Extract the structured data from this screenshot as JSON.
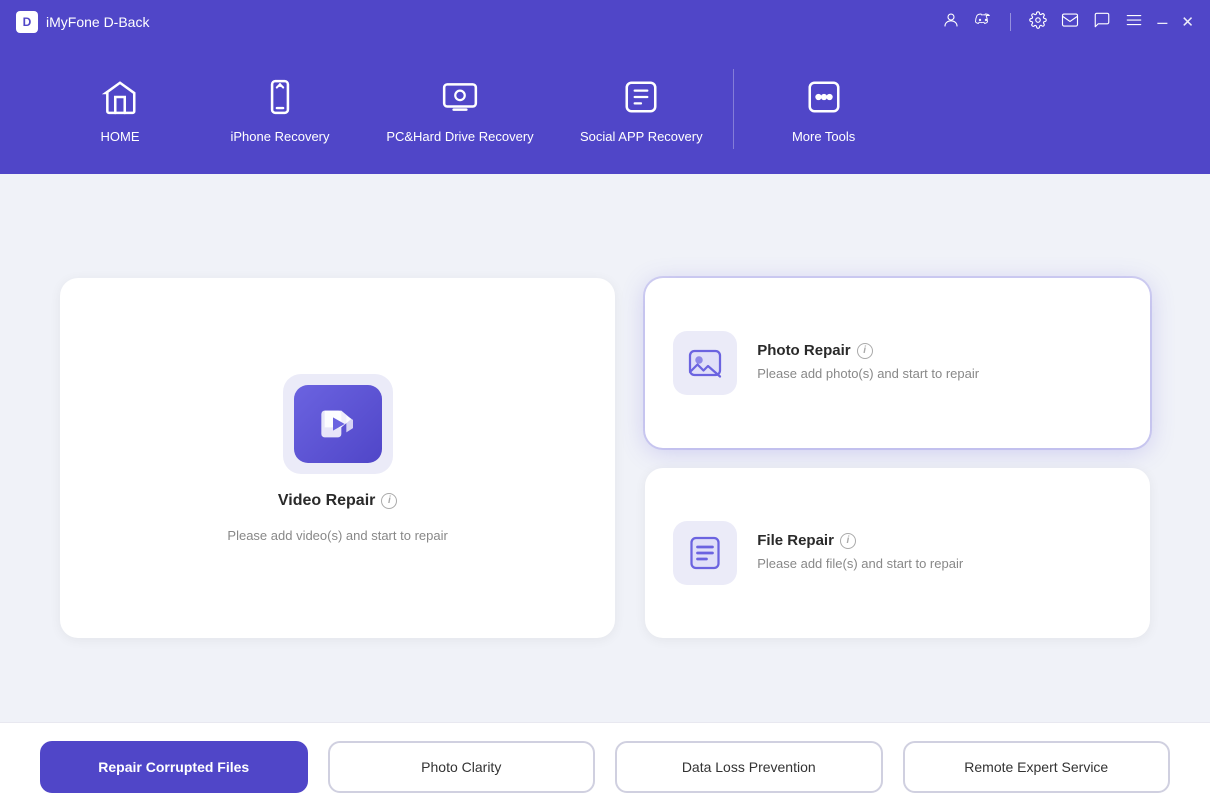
{
  "app": {
    "title": "iMyFone D-Back",
    "logo": "D"
  },
  "titlebar": {
    "icons": [
      "person-icon",
      "discord-icon",
      "settings-icon",
      "mail-icon",
      "chat-icon",
      "menu-icon",
      "minimize-icon",
      "close-icon"
    ],
    "minimize_label": "–",
    "close_label": "✕"
  },
  "nav": {
    "items": [
      {
        "id": "home",
        "label": "HOME",
        "active": false
      },
      {
        "id": "iphone-recovery",
        "label": "iPhone Recovery",
        "active": false
      },
      {
        "id": "pc-hard-drive",
        "label": "PC&Hard Drive Recovery",
        "active": false
      },
      {
        "id": "social-app",
        "label": "Social APP Recovery",
        "active": false
      },
      {
        "id": "more-tools",
        "label": "More Tools",
        "active": true
      }
    ]
  },
  "cards": {
    "left": {
      "title": "Video Repair",
      "info": "i",
      "desc": "Please add video(s) and start to repair"
    },
    "right": [
      {
        "id": "photo-repair",
        "title": "Photo Repair",
        "info": "i",
        "desc": "Please add photo(s) and start to repair",
        "active": true
      },
      {
        "id": "file-repair",
        "title": "File Repair",
        "info": "i",
        "desc": "Please add file(s) and start to repair",
        "active": false
      }
    ]
  },
  "bottom": {
    "buttons": [
      {
        "id": "repair-corrupted",
        "label": "Repair Corrupted Files",
        "primary": true
      },
      {
        "id": "photo-clarity",
        "label": "Photo Clarity",
        "primary": false
      },
      {
        "id": "data-loss",
        "label": "Data Loss Prevention",
        "primary": false
      },
      {
        "id": "remote-expert",
        "label": "Remote Expert Service",
        "primary": false
      }
    ]
  }
}
